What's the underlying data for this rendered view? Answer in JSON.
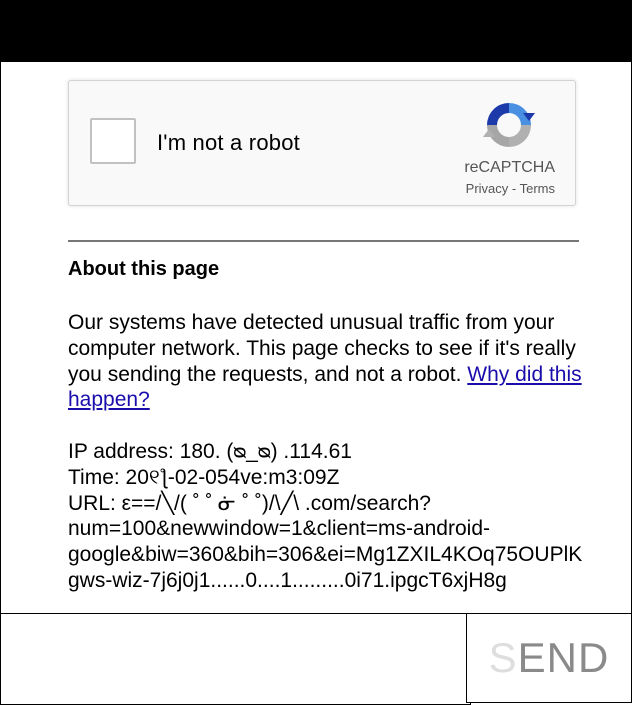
{
  "captcha": {
    "checkbox_label": "I'm not a robot",
    "brand": "reCAPTCHA",
    "privacy_link": "Privacy",
    "separator": " - ",
    "terms_link": "Terms"
  },
  "about": {
    "heading": "About this page",
    "paragraph": "Our systems have detected unusual traffic from your computer network. This page checks to see if it's really you sending the requests, and not a robot. ",
    "link_text": "Why did this happen?"
  },
  "details": {
    "ip_line": "IP address: 180. (ᴓ_ᴓ) .114.61",
    "time_line": "Time: 20୧ƪ-02-054ve:m3:09Z",
    "url_line1": "URL: ε==/╲/( ˚ ˚ ᓃ ˚ ˚)/\\╱\\ .com/search?",
    "url_line2": "num=100&newwindow=1&client=ms-android-",
    "url_line3": "google&biw=360&bih=306&ei=Mg1ZXIL4KOq75OUPlK",
    "url_line4": "gws-wiz-7j6j0j1......0....1.........0i71.ipgcT6xjH8g"
  },
  "bottom": {
    "input_value": "",
    "send_first": "S",
    "send_rest": "END"
  },
  "colors": {
    "top_bar": "#000000",
    "link": "#1a0dab",
    "captcha_bg": "#f9f9f9"
  }
}
